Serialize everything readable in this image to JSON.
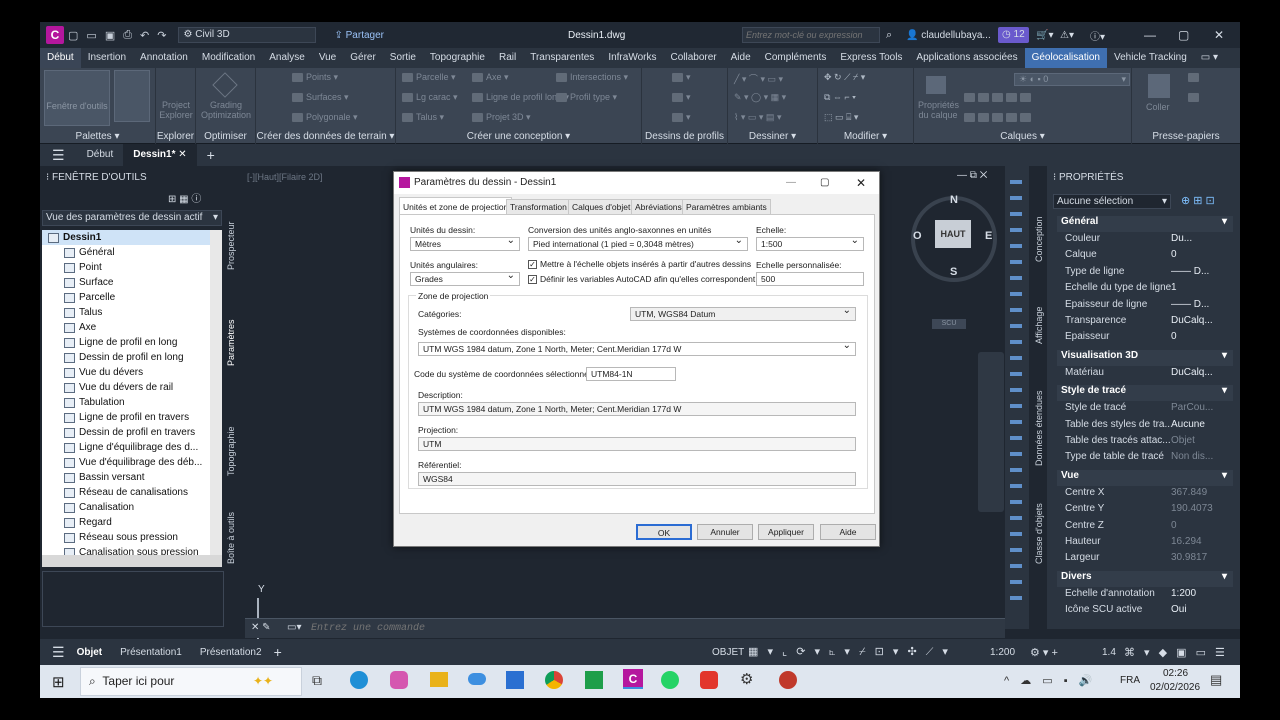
{
  "titlebar": {
    "workspace": "Civil 3D",
    "share": "Partager",
    "document": "Dessin1.dwg",
    "search_placeholder": "Entrez mot-clé ou expression",
    "user": "claudellubaya...",
    "notif_count": "12"
  },
  "ribbon_tabs": [
    "Début",
    "Insertion",
    "Annotation",
    "Modification",
    "Analyse",
    "Vue",
    "Gérer",
    "Sortie",
    "Topographie",
    "Rail",
    "Transparentes",
    "InfraWorks",
    "Collaborer",
    "Aide",
    "Compléments",
    "Express Tools",
    "Applications associées",
    "Géolocalisation",
    "Vehicle Tracking"
  ],
  "ribbon": {
    "palettes": {
      "label": "Palettes ▾",
      "btn": "Fenêtre d'outils"
    },
    "explorer": {
      "label": "Explorer",
      "btn1": "Project",
      "btn2": "Explorer"
    },
    "optimiser": {
      "label": "Optimiser",
      "btn1": "Grading",
      "btn2": "Optimization"
    },
    "terrain": {
      "label": "Créer des données de terrain ▾",
      "items": [
        "Points ▾",
        "Surfaces ▾",
        "Polygonale ▾"
      ]
    },
    "conception": {
      "label": "Créer une conception ▾",
      "items": [
        "Parcelle ▾",
        "Lg carac ▾",
        "Talus ▾",
        "Axe ▾",
        "Ligne de profil long ▾",
        "Projet 3D ▾",
        "Intersections ▾",
        "Profil type ▾"
      ]
    },
    "profils": {
      "label": "Dessins de profils"
    },
    "dessiner": {
      "label": "Dessiner ▾"
    },
    "modifier": {
      "label": "Modifier ▾"
    },
    "calques": {
      "label": "Calques ▾",
      "btn1": "Propriétés",
      "btn2": "du calque"
    },
    "presse": {
      "label": "Presse-papiers",
      "btn": "Coller"
    }
  },
  "doc_tabs": [
    "Début",
    "Dessin1*"
  ],
  "toolspace": {
    "title": "FENÊTRE D'OUTILS",
    "view": "Vue des paramètres de dessin actif",
    "vtabs": [
      "Prospecteur",
      "Paramètres",
      "Topographie",
      "Boîte à outils"
    ],
    "tree": [
      "Dessin1",
      "Général",
      "Point",
      "Surface",
      "Parcelle",
      "Talus",
      "Axe",
      "Ligne de profil en long",
      "Dessin de profil en long",
      "Vue du dévers",
      "Vue du dévers de rail",
      "Tabulation",
      "Ligne de profil en travers",
      "Dessin de profil en travers",
      "Ligne d'équilibrage des d...",
      "Vue d'équilibrage des déb...",
      "Bassin versant",
      "Réseau de canalisations",
      "Canalisation",
      "Regard",
      "Réseau sous pression",
      "Canalisation sous pression"
    ]
  },
  "viewport": {
    "label": "[-][Haut][Filaire 2D]",
    "compass": {
      "n": "N",
      "s": "S",
      "e": "E",
      "w": "O",
      "center": "HAUT",
      "scu": "SCU"
    }
  },
  "command": {
    "placeholder": "Entrez une commande"
  },
  "properties": {
    "title": "PROPRIÉTÉS",
    "selection": "Aucune sélection",
    "vtabs": [
      "Conception",
      "Affichage",
      "Données étendues",
      "Classe d'objets"
    ],
    "sections": [
      {
        "name": "Général",
        "rows": [
          [
            "Couleur",
            "Du..."
          ],
          [
            "Calque",
            "0"
          ],
          [
            "Type de ligne",
            "—— D..."
          ],
          [
            "Echelle du type de ligne",
            "1"
          ],
          [
            "Epaisseur de ligne",
            "—— D..."
          ],
          [
            "Transparence",
            "DuCalq..."
          ],
          [
            "Epaisseur",
            "0"
          ]
        ]
      },
      {
        "name": "Visualisation 3D",
        "rows": [
          [
            "Matériau",
            "DuCalq..."
          ]
        ]
      },
      {
        "name": "Style de tracé",
        "rows": [
          [
            "Style de tracé",
            "ParCou..."
          ],
          [
            "Table des styles de tra...",
            "Aucune"
          ],
          [
            "Table des tracés attac...",
            "Objet"
          ],
          [
            "Type de table de tracé",
            "Non dis..."
          ]
        ]
      },
      {
        "name": "Vue",
        "rows": [
          [
            "Centre X",
            "367.849"
          ],
          [
            "Centre Y",
            "190.4073"
          ],
          [
            "Centre Z",
            "0"
          ],
          [
            "Hauteur",
            "16.294"
          ],
          [
            "Largeur",
            "30.9817"
          ]
        ]
      },
      {
        "name": "Divers",
        "rows": [
          [
            "Echelle d'annotation",
            "1:200"
          ],
          [
            "Icône SCU active",
            "Oui"
          ]
        ]
      }
    ]
  },
  "layout_tabs": [
    "Objet",
    "Présentation1",
    "Présentation2"
  ],
  "statusbar": {
    "mode": "OBJET",
    "scale": "1:200",
    "factor": "1.4"
  },
  "dialog": {
    "title": "Paramètres du dessin - Dessin1",
    "tabs": [
      "Unités et zone de projection",
      "Transformation",
      "Calques d'objet",
      "Abréviations",
      "Paramètres ambiants"
    ],
    "units_label": "Unités du dessin:",
    "units_value": "Mètres",
    "conv_label": "Conversion des unités anglo-saxonnes en unités",
    "conv_value": "Pied international (1 pied = 0,3048 mètres)",
    "scale_label": "Echelle:",
    "scale_value": "1:500",
    "ang_label": "Unités angulaires:",
    "ang_value": "Grades",
    "chk1": "Mettre à l'échelle objets insérés à partir d'autres dessins",
    "chk2": "Définir les variables AutoCAD afin qu'elles correspondent",
    "custom_label": "Echelle personnalisée:",
    "custom_value": "500",
    "zone_group": "Zone de projection",
    "cat_label": "Catégories:",
    "cat_value": "UTM, WGS84 Datum",
    "sys_label": "Systèmes de coordonnées disponibles:",
    "sys_value": "UTM WGS 1984 datum, Zone 1 North, Meter; Cent.Meridian 177d W",
    "code_label": "Code du système de coordonnées sélectionné:",
    "code_value": "UTM84-1N",
    "desc_label": "Description:",
    "desc_value": "UTM WGS 1984 datum, Zone 1 North, Meter; Cent.Meridian 177d W",
    "proj_label": "Projection:",
    "proj_value": "UTM",
    "ref_label": "Référentiel:",
    "ref_value": "WGS84",
    "buttons": [
      "OK",
      "Annuler",
      "Appliquer",
      "Aide"
    ]
  },
  "taskbar": {
    "search": "Taper ici pour",
    "lang": "FRA",
    "time": "02:26",
    "date": "02/02/2026"
  }
}
